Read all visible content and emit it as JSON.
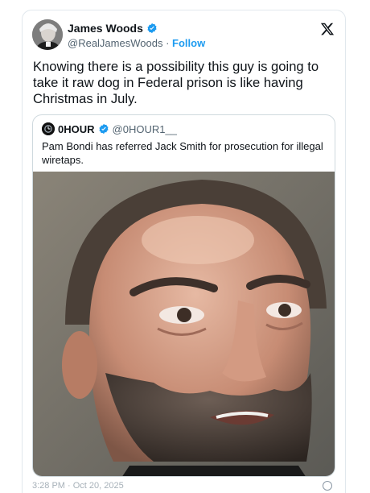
{
  "author": {
    "name": "James Woods",
    "handle": "@RealJamesWoods",
    "separator": "·",
    "follow_label": "Follow"
  },
  "tweet": {
    "text": "Knowing there is a possibility this guy is going to take it raw dog in Federal prison is like having Christmas in July."
  },
  "quoted": {
    "name": "0HOUR",
    "handle": "@0HOUR1__",
    "text": "Pam Bondi has referred Jack Smith for prosecution for illegal wiretaps."
  },
  "footer": {
    "timestamp_partial": "3:28 PM · Oct 20, 2025"
  },
  "colors": {
    "accent": "#1d9bf0",
    "text": "#0f1419",
    "muted": "#536471",
    "border": "#cfd9de"
  },
  "icons": [
    "verified-badge-icon",
    "x-logo-icon",
    "info-icon"
  ]
}
